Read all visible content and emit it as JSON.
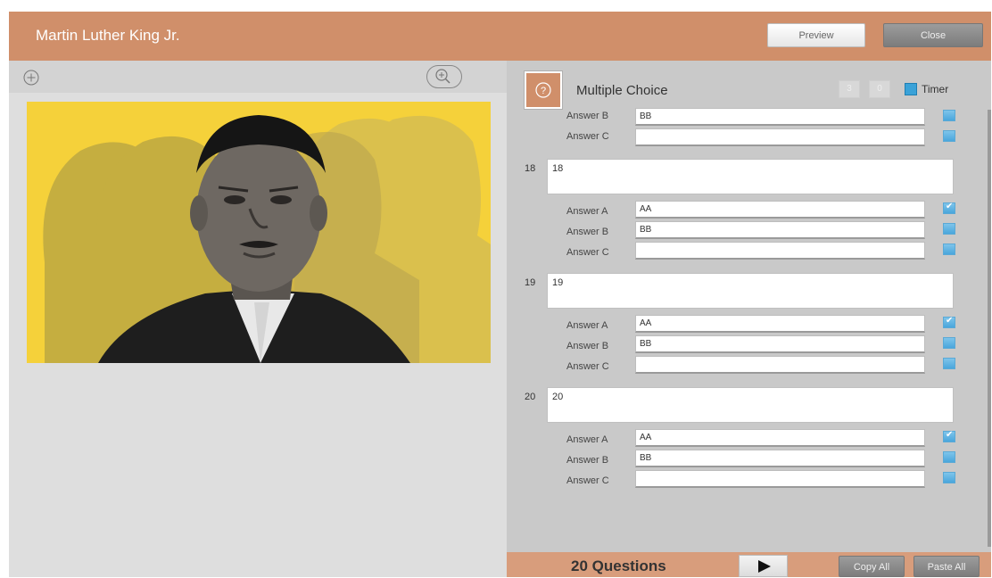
{
  "header": {
    "title": "Martin Luther King Jr.",
    "preview_label": "Preview",
    "close_label": "Close"
  },
  "left_panel": {
    "add_icon": "plus-circle-icon",
    "zoom_icon": "zoom-in-icon",
    "image_subject": "portrait"
  },
  "question_panel": {
    "type_icon": "question-mark-icon",
    "type_label": "Multiple Choice",
    "timer_minutes": "3",
    "timer_seconds": "0",
    "timer_label": "Timer",
    "timer_checked": true,
    "partial_answers": [
      {
        "label": "Answer B",
        "value": "BB",
        "checked": false
      },
      {
        "label": "Answer C",
        "value": "",
        "checked": false
      }
    ],
    "questions": [
      {
        "number": "18",
        "text": "18",
        "answers": [
          {
            "label": "Answer A",
            "value": "AA",
            "checked": true
          },
          {
            "label": "Answer B",
            "value": "BB",
            "checked": false
          },
          {
            "label": "Answer C",
            "value": "",
            "checked": false
          }
        ]
      },
      {
        "number": "19",
        "text": "19",
        "answers": [
          {
            "label": "Answer A",
            "value": "AA",
            "checked": true
          },
          {
            "label": "Answer B",
            "value": "BB",
            "checked": false
          },
          {
            "label": "Answer C",
            "value": "",
            "checked": false
          }
        ]
      },
      {
        "number": "20",
        "text": "20",
        "answers": [
          {
            "label": "Answer A",
            "value": "AA",
            "checked": true
          },
          {
            "label": "Answer B",
            "value": "BB",
            "checked": false
          },
          {
            "label": "Answer C",
            "value": "",
            "checked": false
          }
        ]
      }
    ]
  },
  "footer": {
    "count_label": "20 Questions",
    "play_icon": "play-icon",
    "copy_label": "Copy All",
    "paste_label": "Paste All"
  },
  "colors": {
    "accent": "#d08f6a",
    "footer": "#d89d7c",
    "checkbox": "#4aa6dc",
    "panel_bg": "#c9c9c9"
  }
}
